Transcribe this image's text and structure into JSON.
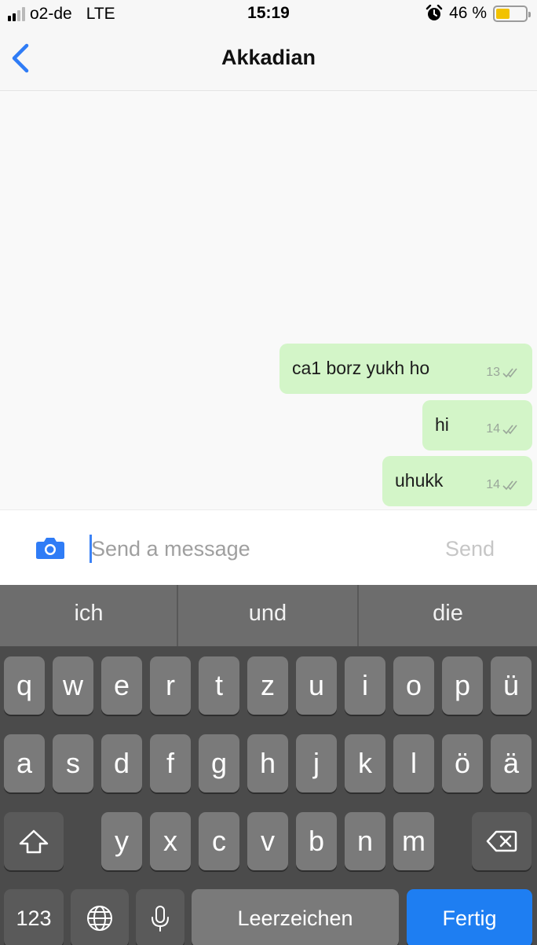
{
  "status_bar": {
    "carrier": "o2-de",
    "network": "LTE",
    "time": "15:19",
    "battery_text": "46 %",
    "battery_level": 0.46,
    "signal_bars": 2,
    "icons": [
      "signal-icon",
      "alarm-icon",
      "battery-icon"
    ]
  },
  "nav": {
    "title": "Akkadian",
    "back_icon": "chevron-left-icon",
    "accent_color": "#2f7cf6"
  },
  "messages": [
    {
      "text": "ca1 borz yukh ho",
      "time": "13",
      "status_icon": "double-check-icon"
    },
    {
      "text": "hi",
      "time": "14",
      "status_icon": "double-check-icon"
    },
    {
      "text": "uhukk",
      "time": "14",
      "status_icon": "double-check-icon"
    }
  ],
  "composer": {
    "camera_icon": "camera-icon",
    "placeholder": "Send a message",
    "value": "",
    "send_label": "Send"
  },
  "keyboard": {
    "suggestions": [
      "ich",
      "und",
      "die"
    ],
    "row1": [
      "q",
      "w",
      "e",
      "r",
      "t",
      "z",
      "u",
      "i",
      "o",
      "p",
      "ü"
    ],
    "row2": [
      "a",
      "s",
      "d",
      "f",
      "g",
      "h",
      "j",
      "k",
      "l",
      "ö",
      "ä"
    ],
    "row3": [
      "y",
      "x",
      "c",
      "v",
      "b",
      "n",
      "m"
    ],
    "numbers_label": "123",
    "space_label": "Leerzeichen",
    "return_label": "Fertig",
    "icons": [
      "shift-icon",
      "backspace-icon",
      "globe-icon",
      "microphone-icon"
    ],
    "return_color": "#1e7ef2"
  }
}
